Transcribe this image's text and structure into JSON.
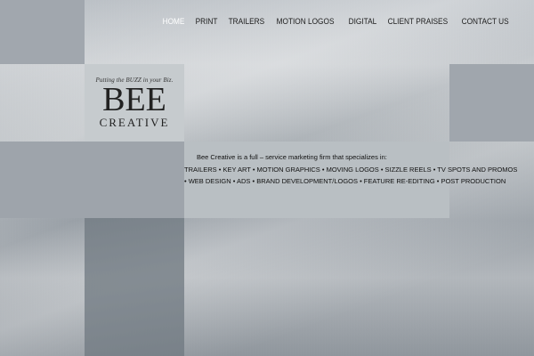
{
  "nav": {
    "items": [
      "HOME",
      "PRINT",
      "TRAILERS",
      "MOTION LOGOS",
      "DIGITAL",
      "CLIENT PRAISES",
      "CONTACT US"
    ],
    "active": "HOME"
  },
  "logo": {
    "tagline": "Putting the BUZZ in your Biz.",
    "main": "BEE",
    "sub": "CREATIVE"
  },
  "description": {
    "intro": "Bee Creative is a full – service marketing firm that specializes in:",
    "services_line1": "TRAILERS • KEY ART • MOTION GRAPHICS • MOVING LOGOS • SIZZLE REELS • TV SPOTS AND PROMOS",
    "services_line2": "• WEB DESIGN • ADS • BRAND DEVELOPMENT/LOGOS • FEATURE RE-EDITING • POST PRODUCTION"
  },
  "colors": {
    "active_nav": "#ffffff",
    "nav_text": "#1d1d1d",
    "logo_panel": "#c6cbce",
    "description_panel": "#b9bfc3"
  }
}
